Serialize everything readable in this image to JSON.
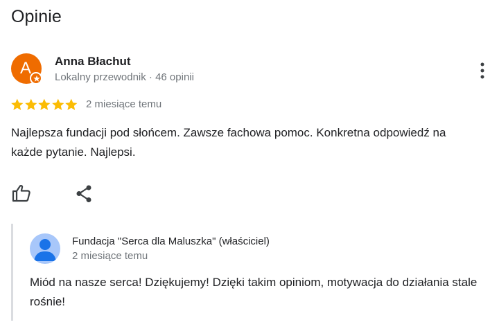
{
  "section": {
    "title": "Opinie"
  },
  "review": {
    "author": {
      "initial": "A",
      "name": "Anna Błachut",
      "meta": "Lokalny przewodnik · 46 opinii",
      "avatar_color": "#ef6c00"
    },
    "rating": 5,
    "rating_max": 5,
    "date": "2 miesiące temu",
    "text": "Najlepsza fundacji pod słońcem. Zawsze fachowa pomoc. Konkretna odpowiedź na każde pytanie. Najlepsi.",
    "actions": {
      "like_icon": "thumb-up-outline-icon",
      "share_icon": "share-icon",
      "more_icon": "more-vert-icon"
    }
  },
  "owner_reply": {
    "name": "Fundacja \"Serca dla Maluszka\" (właściciel)",
    "date": "2 miesiące temu",
    "text": "Miód na nasze serca! Dziękujemy! Dzięki takim opiniom, motywacja do działania stale rośnie!",
    "avatar_icon": "person-placeholder-icon",
    "avatar_color": "#a8c7fa"
  },
  "colors": {
    "star": "#fbbc04",
    "secondary_text": "#70757a",
    "icon": "#3c4043"
  }
}
